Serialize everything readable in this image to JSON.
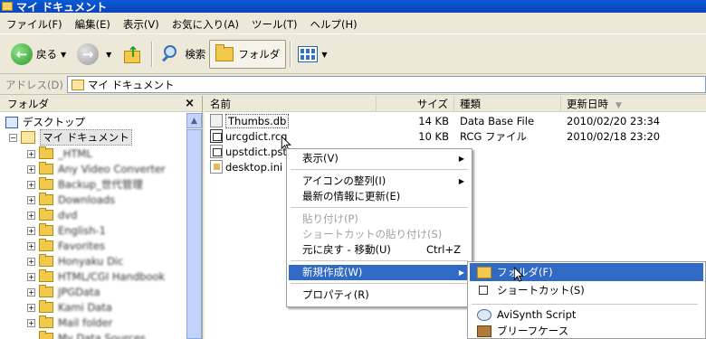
{
  "window": {
    "title": "マイ ドキュメント"
  },
  "menu": [
    "ファイル(F)",
    "編集(E)",
    "表示(V)",
    "お気に入り(A)",
    "ツール(T)",
    "ヘルプ(H)"
  ],
  "toolbar": {
    "back": "戻る",
    "search": "検索",
    "folders": "フォルダ"
  },
  "address": {
    "label": "アドレス(D)",
    "value": "マイ ドキュメント"
  },
  "folder_pane": {
    "title": "フォルダ",
    "close": "×",
    "tree": [
      {
        "label": "デスクトップ"
      },
      {
        "label": "マイ ドキュメント"
      },
      {
        "label": "_HTML"
      },
      {
        "label": "Any Video Converter"
      },
      {
        "label": "Backup_世代管理"
      },
      {
        "label": "Downloads"
      },
      {
        "label": "dvd"
      },
      {
        "label": "English-1"
      },
      {
        "label": "Favorites"
      },
      {
        "label": "Honyaku Dic"
      },
      {
        "label": "HTML/CGI Handbook"
      },
      {
        "label": "JPGData"
      },
      {
        "label": "Kami Data"
      },
      {
        "label": "Mail folder"
      },
      {
        "label": "My Data Sources"
      }
    ]
  },
  "columns": {
    "name": "名前",
    "size": "サイズ",
    "type": "種類",
    "modified": "更新日時"
  },
  "files": [
    {
      "name": "Thumbs.db",
      "size": "14 KB",
      "type": "Data Base File",
      "modified": "2010/02/20 23:34"
    },
    {
      "name": "urcgdict.rcg",
      "size": "10 KB",
      "type": "RCG ファイル",
      "modified": "2010/02/18 23:20"
    },
    {
      "name": "upstdict.pst",
      "size": "",
      "type": "",
      "modified": ""
    },
    {
      "name": "desktop.ini",
      "size": "",
      "type": "",
      "modified": ""
    }
  ],
  "context_menu": {
    "view": "表示(V)",
    "arrange": "アイコンの整列(I)",
    "refresh": "最新の情報に更新(E)",
    "paste": "貼り付け(P)",
    "paste_shortcut": "ショートカットの貼り付け(S)",
    "undo": "元に戻す - 移動(U)",
    "undo_shortcut": "Ctrl+Z",
    "new": "新規作成(W)",
    "properties": "プロパティ(R)"
  },
  "submenu": {
    "folder": "フォルダ(F)",
    "shortcut": "ショートカット(S)",
    "avisynth": "AviSynth Script",
    "briefcase": "ブリーフケース"
  }
}
